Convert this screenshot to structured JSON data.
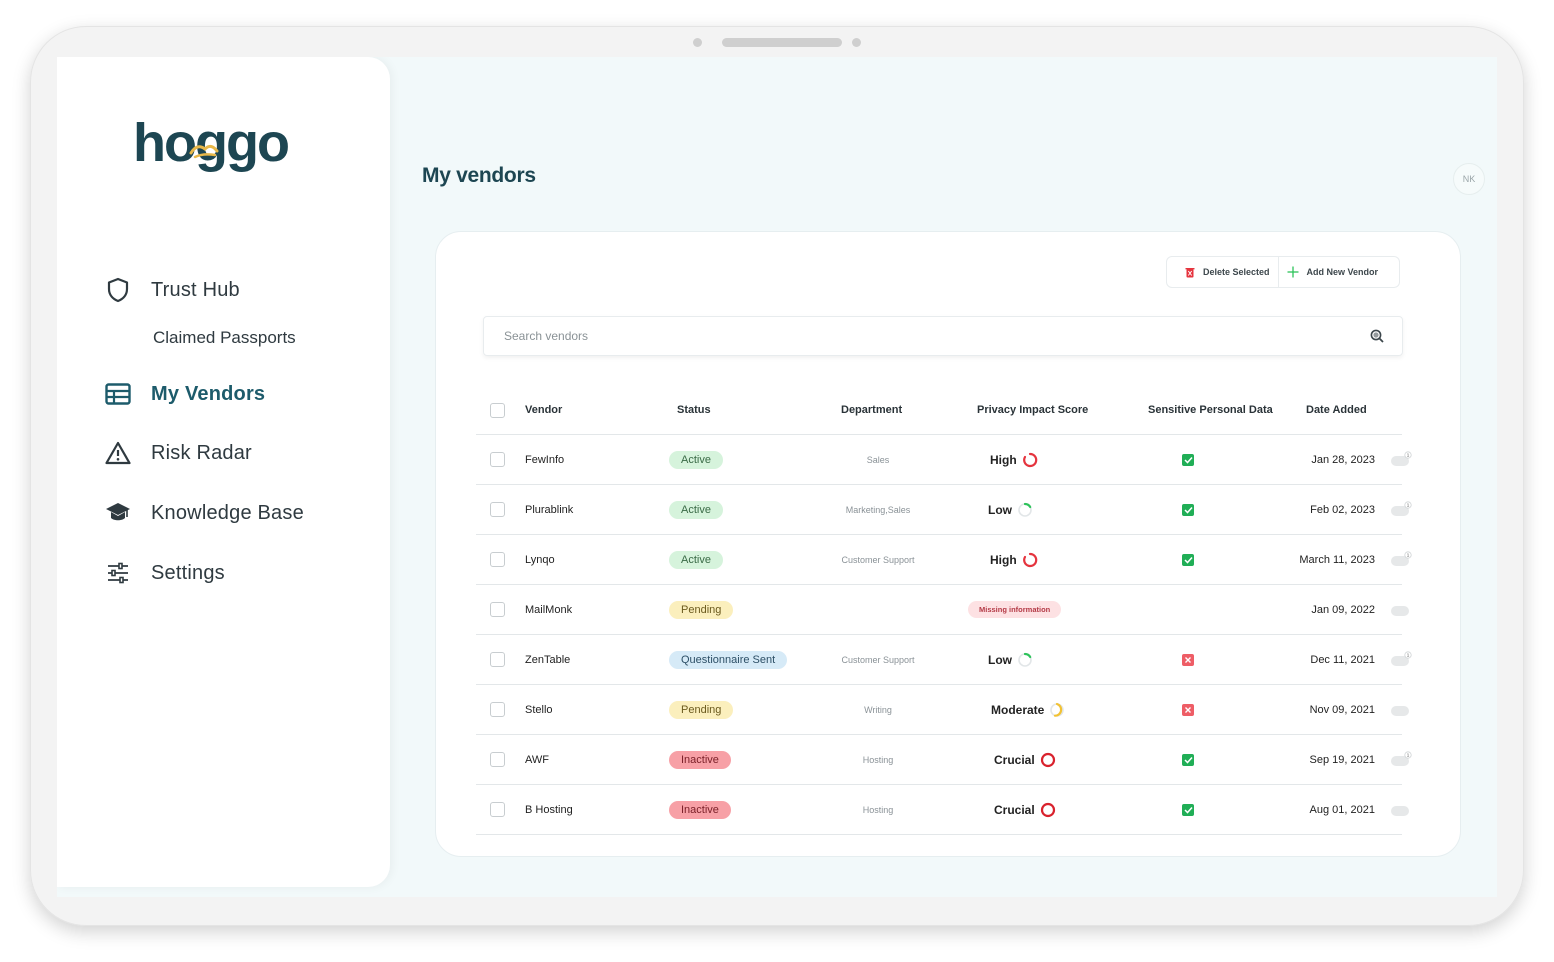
{
  "app": {
    "brand": "hoggo",
    "page_title": "My vendors",
    "avatar_initials": "NK"
  },
  "sidebar": {
    "items": [
      {
        "label": "Trust Hub",
        "icon": "shield-icon"
      },
      {
        "label": "Claimed Passports",
        "icon": ""
      },
      {
        "label": "My Vendors",
        "icon": "table-icon",
        "active": true
      },
      {
        "label": "Risk Radar",
        "icon": "warning-icon"
      },
      {
        "label": "Knowledge Base",
        "icon": "graduation-cap-icon"
      },
      {
        "label": "Settings",
        "icon": "sliders-icon"
      }
    ]
  },
  "toolbar": {
    "delete_label": "Delete Selected",
    "add_label": "Add New Vendor"
  },
  "search": {
    "placeholder": "Search vendors"
  },
  "table": {
    "headers": [
      "Vendor",
      "Status",
      "Department",
      "Privacy Impact Score",
      "Sensitive Personal Data",
      "Date Added"
    ],
    "rows": [
      {
        "vendor": "FewInfo",
        "status": "Active",
        "status_type": "active",
        "department": "Sales",
        "score": "High",
        "score_type": "high",
        "sensitive": "yes",
        "date": "Jan 28, 2023",
        "comment_badge": true
      },
      {
        "vendor": "Plurablink",
        "status": "Active",
        "status_type": "active",
        "department": "Marketing,Sales",
        "score": "Low",
        "score_type": "low",
        "sensitive": "yes",
        "date": "Feb 02, 2023",
        "comment_badge": true
      },
      {
        "vendor": "Lynqo",
        "status": "Active",
        "status_type": "active",
        "department": "Customer Support",
        "score": "High",
        "score_type": "high",
        "sensitive": "yes",
        "date": "March 11, 2023",
        "comment_badge": true
      },
      {
        "vendor": "MailMonk",
        "status": "Pending",
        "status_type": "pending",
        "department": "",
        "score": "Missing information",
        "score_type": "missing",
        "sensitive": "",
        "date": "Jan 09, 2022",
        "comment_badge": false
      },
      {
        "vendor": "ZenTable",
        "status": "Questionnaire Sent",
        "status_type": "sent",
        "department": "Customer Support",
        "score": "Low",
        "score_type": "low",
        "sensitive": "no",
        "date": "Dec 11, 2021",
        "comment_badge": true
      },
      {
        "vendor": "Stello",
        "status": "Pending",
        "status_type": "pending",
        "department": "Writing",
        "score": "Moderate",
        "score_type": "moderate",
        "sensitive": "no",
        "date": "Nov 09, 2021",
        "comment_badge": false
      },
      {
        "vendor": "AWF",
        "status": "Inactive",
        "status_type": "inactive",
        "department": "Hosting",
        "score": "Crucial",
        "score_type": "crucial",
        "sensitive": "yes",
        "date": "Sep 19, 2021",
        "comment_badge": true
      },
      {
        "vendor": "B Hosting",
        "status": "Inactive",
        "status_type": "inactive",
        "department": "Hosting",
        "score": "Crucial",
        "score_type": "crucial",
        "sensitive": "yes",
        "date": "Aug 01, 2021",
        "comment_badge": false
      }
    ]
  },
  "colors": {
    "brand_dark": "#1d4652",
    "brand_accent": "#e8b84a",
    "high": "#e5343e",
    "low": "#2ec25b",
    "moderate": "#f2c233",
    "crucial": "#d9222d"
  }
}
